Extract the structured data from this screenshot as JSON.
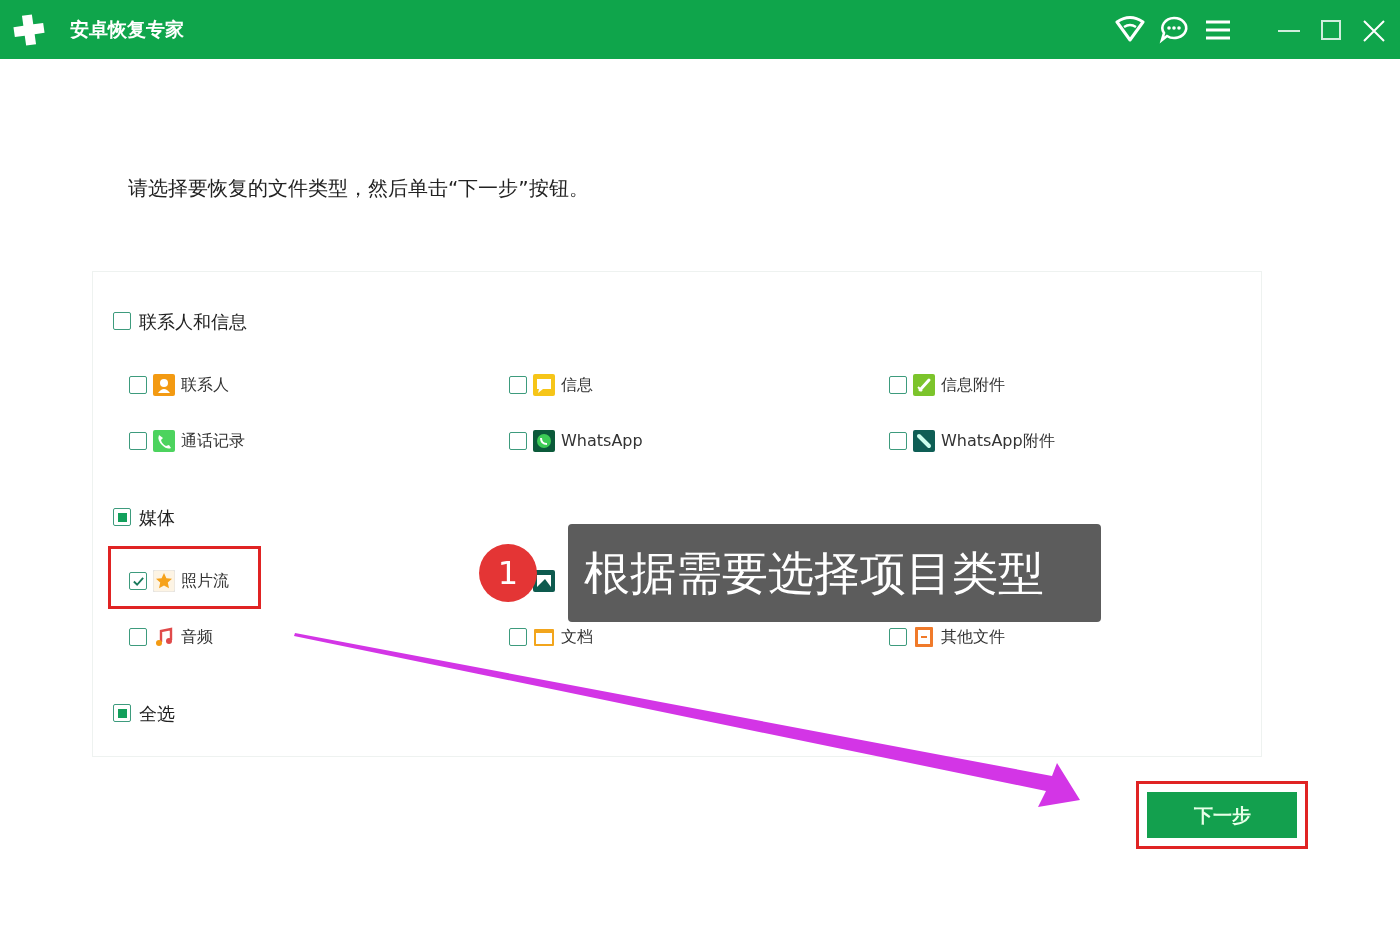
{
  "window": {
    "title": "安卓恢复专家"
  },
  "instruction": "请选择要恢复的文件类型，然后单击“下一步”按钮。",
  "groups": [
    {
      "label": "联系人和信息",
      "partial": false,
      "rows": [
        [
          {
            "label": "联系人",
            "kind": "contacts",
            "checked": false,
            "highlighted": false
          },
          {
            "label": "信息",
            "kind": "messages",
            "checked": false,
            "highlighted": false
          },
          {
            "label": "信息附件",
            "kind": "attachments",
            "checked": false,
            "highlighted": false
          }
        ],
        [
          {
            "label": "通话记录",
            "kind": "calls",
            "checked": false,
            "highlighted": false
          },
          {
            "label": "WhatsApp",
            "kind": "whatsapp",
            "checked": false,
            "highlighted": false
          },
          {
            "label": "WhatsApp附件",
            "kind": "whatsapp-attachments",
            "checked": false,
            "highlighted": false
          }
        ]
      ]
    },
    {
      "label": "媒体",
      "partial": true,
      "rows": [
        [
          {
            "label": "照片流",
            "kind": "photostream",
            "checked": true,
            "highlighted": true
          },
          {
            "kind": "photos"
          }
        ],
        [
          {
            "label": "音频",
            "kind": "audio",
            "checked": false,
            "highlighted": false
          },
          {
            "label": "文档",
            "kind": "documents",
            "checked": false,
            "highlighted": false
          },
          {
            "label": "其他文件",
            "kind": "other",
            "checked": false,
            "highlighted": false
          }
        ]
      ]
    }
  ],
  "select_all": {
    "label": "全选",
    "partial": true
  },
  "next_button": {
    "label": "下一步",
    "highlighted": true
  },
  "callout": {
    "number": "1",
    "text": "根据需要选择项目类型"
  }
}
